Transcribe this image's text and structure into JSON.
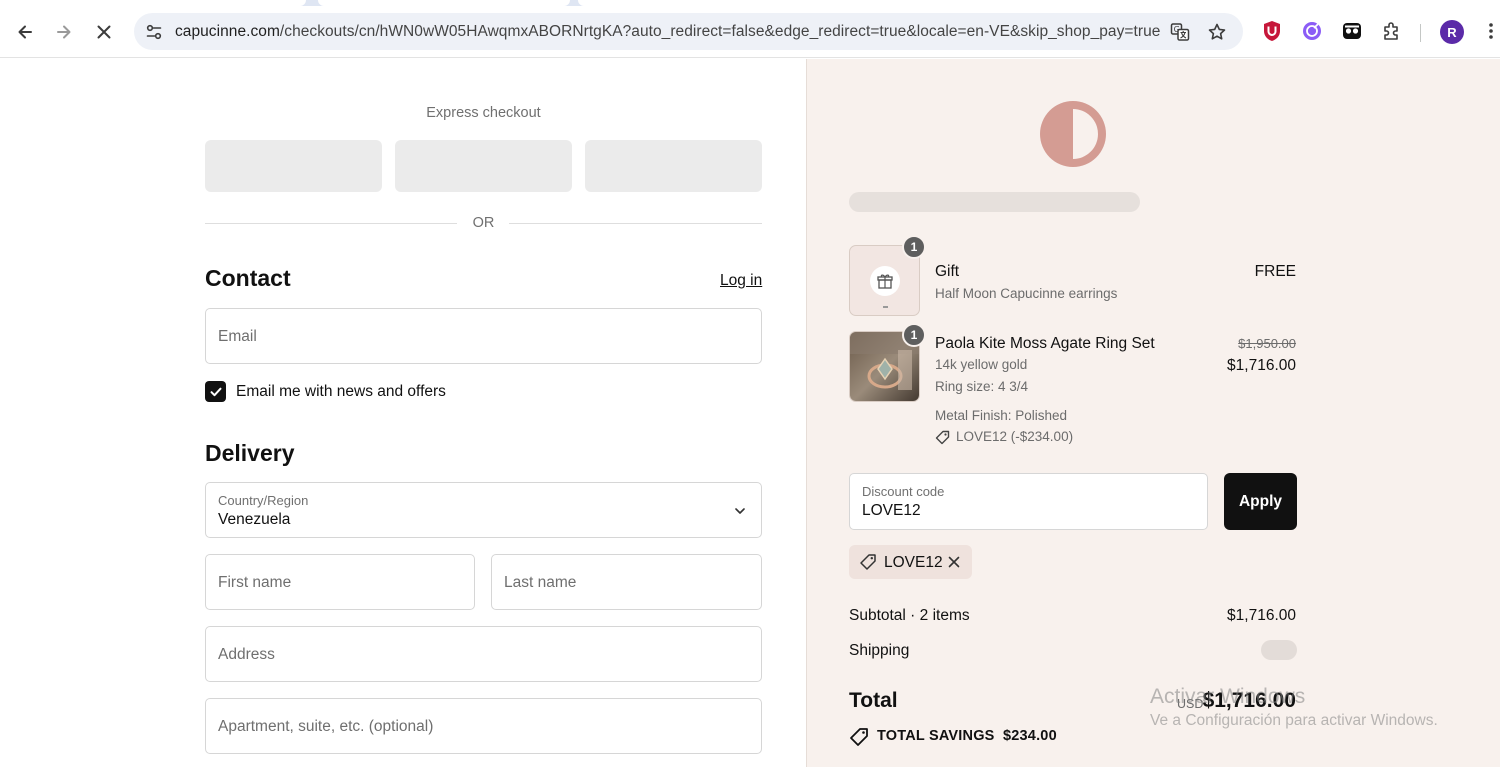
{
  "browser": {
    "url_host": "capucinne.com",
    "url_path": "/checkouts/cn/hWN0wW05HAwqmxABORNrtgKA?auto_redirect=false&edge_redirect=true&locale=en-VE&skip_shop_pay=true",
    "profile_initial": "R"
  },
  "checkout": {
    "express_title": "Express checkout",
    "or_text": "OR",
    "contact": {
      "heading": "Contact",
      "login_label": "Log in",
      "email_placeholder": "Email",
      "news_label": "Email me with news and offers",
      "news_checked": true
    },
    "delivery": {
      "heading": "Delivery",
      "country_label": "Country/Region",
      "country_value": "Venezuela",
      "first_name_placeholder": "First name",
      "last_name_placeholder": "Last name",
      "address_placeholder": "Address",
      "apartment_placeholder": "Apartment, suite, etc. (optional)"
    }
  },
  "summary": {
    "items": [
      {
        "qty": "1",
        "name": "Gift",
        "line1": "Half Moon Capucinne earrings",
        "price": "FREE"
      },
      {
        "qty": "1",
        "name": "Paola Kite Moss Agate Ring Set",
        "line1": "14k yellow gold",
        "line2": "Ring size: 4 3/4",
        "line3": "Metal Finish: Polished",
        "discount_tag": "LOVE12 (-$234.00)",
        "original_price": "$1,950.00",
        "price": "$1,716.00"
      }
    ],
    "discount_label": "Discount code",
    "discount_value": "LOVE12",
    "apply_label": "Apply",
    "applied_code": "LOVE12",
    "subtotal_label": "Subtotal · 2 items",
    "subtotal_value": "$1,716.00",
    "shipping_label": "Shipping",
    "total_label": "Total",
    "total_currency": "USD",
    "total_value": "$1,716.00",
    "savings_label": "TOTAL SAVINGS",
    "savings_value": "$234.00"
  },
  "watermark": {
    "line1": "Activar Windows",
    "line2": "Ve a Configuración para activar Windows."
  },
  "colors": {
    "summary_bg": "#f8f1ed",
    "logo": "#d49c93",
    "button_dark": "#111111"
  }
}
